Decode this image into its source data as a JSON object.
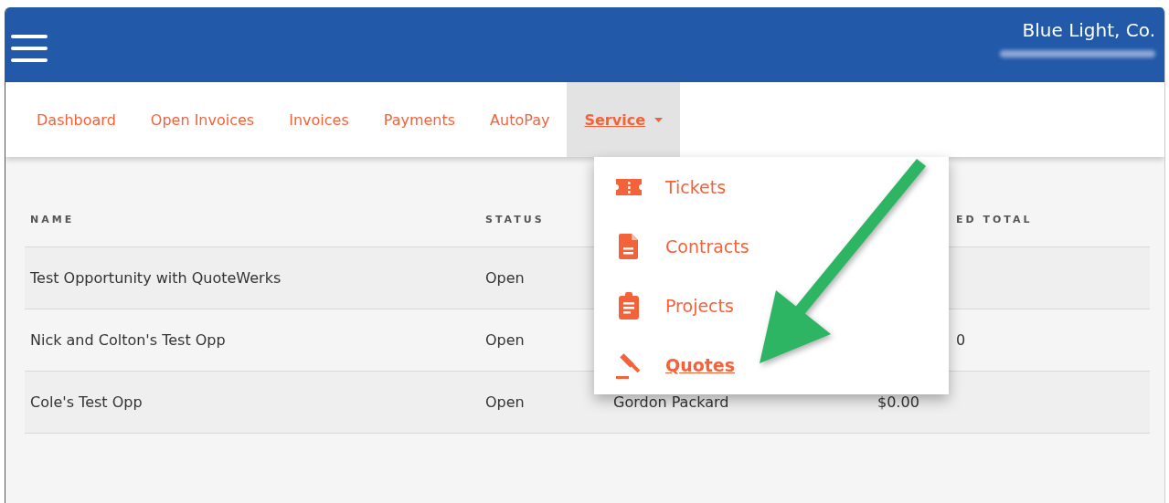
{
  "header": {
    "company": "Blue Light, Co."
  },
  "nav": {
    "tabs": [
      {
        "label": "Dashboard",
        "selected": false,
        "dropdown": false
      },
      {
        "label": "Open Invoices",
        "selected": false,
        "dropdown": false
      },
      {
        "label": "Invoices",
        "selected": false,
        "dropdown": false
      },
      {
        "label": "Payments",
        "selected": false,
        "dropdown": false
      },
      {
        "label": "AutoPay",
        "selected": false,
        "dropdown": false
      },
      {
        "label": "Service",
        "selected": true,
        "dropdown": true
      }
    ]
  },
  "menu": {
    "items": [
      {
        "label": "Tickets",
        "kind": "ticket",
        "selected": false
      },
      {
        "label": "Contracts",
        "kind": "document",
        "selected": false
      },
      {
        "label": "Projects",
        "kind": "clipboard",
        "selected": false
      },
      {
        "label": "Quotes",
        "kind": "gavel",
        "selected": true
      }
    ]
  },
  "table": {
    "columns": [
      {
        "label": "NAME"
      },
      {
        "label": "STATUS"
      },
      {
        "label": "ED TOTAL",
        "cut": true
      }
    ],
    "rows": [
      {
        "name": "Test Opportunity with QuoteWerks",
        "status": "Open"
      },
      {
        "name": "Nick and Colton's Test Opp",
        "status": "Open",
        "column_4": "0",
        "column_4_cut": true
      },
      {
        "name": "Cole's Test Opp",
        "status": "Open",
        "column_3": "Gordon Packard",
        "column_4": "$0.00",
        "column_4_cut": false
      }
    ]
  }
}
